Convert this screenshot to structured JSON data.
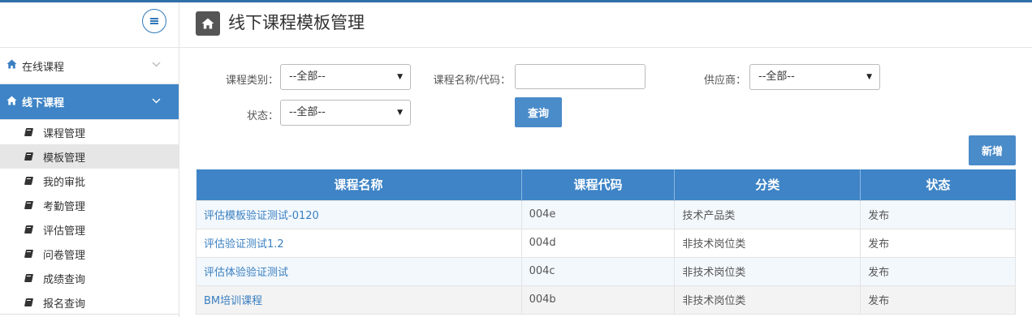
{
  "sidebar": {
    "groups": [
      {
        "label": "在线课程",
        "icon": "home-icon",
        "expanded": false
      },
      {
        "label": "线下课程",
        "icon": "home-icon",
        "expanded": true
      }
    ],
    "items": [
      {
        "label": "课程管理"
      },
      {
        "label": "模板管理",
        "active": true
      },
      {
        "label": "我的审批"
      },
      {
        "label": "考勤管理"
      },
      {
        "label": "评估管理"
      },
      {
        "label": "问卷管理"
      },
      {
        "label": "成绩查询"
      },
      {
        "label": "报名查询"
      }
    ]
  },
  "page": {
    "title": "线下课程模板管理"
  },
  "filters": {
    "category_label": "课程类别：",
    "category_value": "--全部--",
    "name_label": "课程名称/代码：",
    "name_value": "",
    "supplier_label": "供应商：",
    "supplier_value": "--全部--",
    "status_label": "状态：",
    "status_value": "--全部--",
    "query_button": "查询"
  },
  "actions": {
    "add_button": "新增"
  },
  "table": {
    "headers": [
      "课程名称",
      "课程代码",
      "分类",
      "状态"
    ],
    "rows": [
      [
        "评估模板验证测试-0120",
        "004e",
        "技术产品类",
        "发布"
      ],
      [
        "评估验证测试1.2",
        "004d",
        "非技术岗位类",
        "发布"
      ],
      [
        "评估体验验证测试",
        "004c",
        "非技术岗位类",
        "发布"
      ],
      [
        "BM培训课程",
        "004b",
        "非技术岗位类",
        "发布"
      ]
    ]
  },
  "colors": {
    "accent": "#3e84c6",
    "link": "#3a7fc0",
    "topline": "#2f6fa7"
  }
}
